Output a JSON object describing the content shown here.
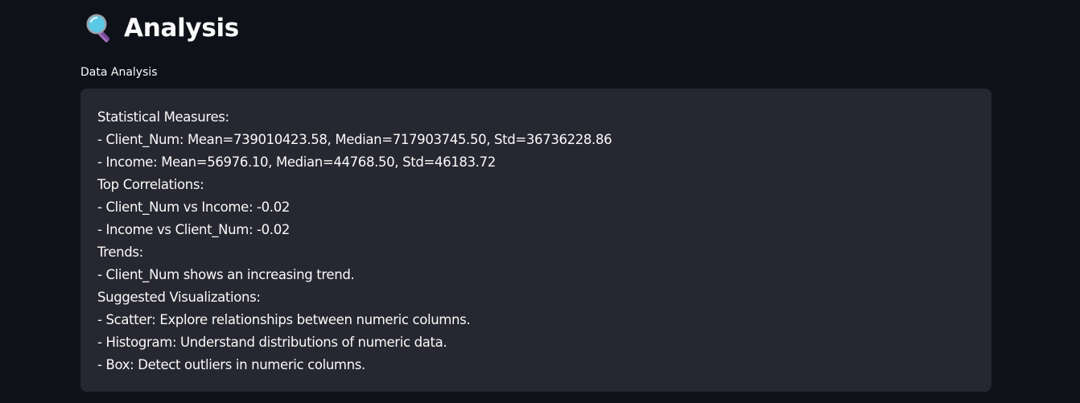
{
  "header": {
    "icon": "magnifying-glass-icon",
    "title": "Analysis"
  },
  "analysis_field": {
    "label": "Data Analysis",
    "lines": [
      "Statistical Measures:",
      "- Client_Num: Mean=739010423.58, Median=717903745.50, Std=36736228.86",
      "- Income: Mean=56976.10, Median=44768.50, Std=46183.72",
      "Top Correlations:",
      "- Client_Num vs Income: -0.02",
      "- Income vs Client_Num: -0.02",
      "Trends:",
      "- Client_Num shows an increasing trend.",
      "Suggested Visualizations:",
      "- Scatter: Explore relationships between numeric columns.",
      "- Histogram: Understand distributions of numeric data.",
      "- Box: Detect outliers in numeric columns."
    ]
  },
  "colors": {
    "background": "#0e1117",
    "textarea_background": "#262730",
    "text": "#fafafa",
    "icon_lens": "#5bc8e8",
    "icon_handle": "#7a4a9a"
  }
}
